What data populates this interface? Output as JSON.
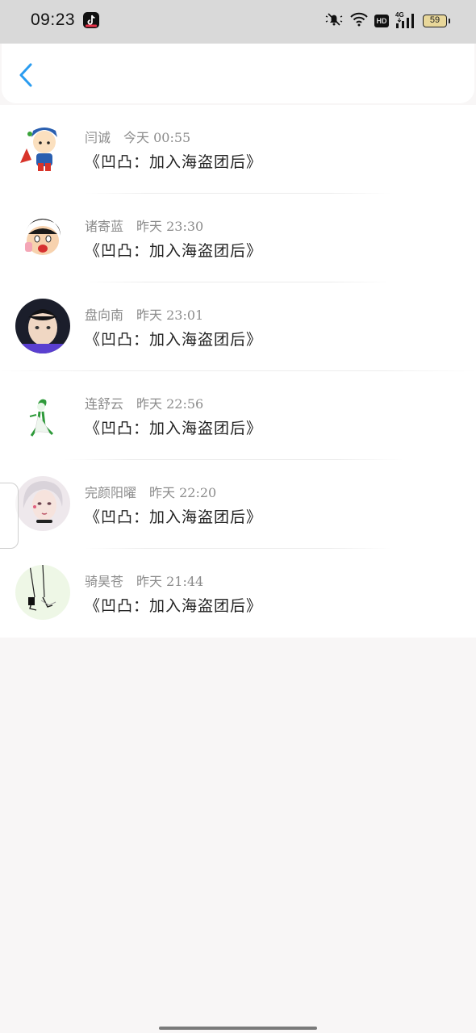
{
  "status_bar": {
    "time": "09:23",
    "battery": "59",
    "network": "4G",
    "hd": "HD"
  },
  "header": {
    "back_icon": "chevron-left-icon",
    "accent_color": "#2a9cf0"
  },
  "messages": [
    {
      "name": "闫诚",
      "time": "今天 00:55",
      "text": "《凹凸：加入海盗团后》"
    },
    {
      "name": "诸寄蓝",
      "time": "昨天 23:30",
      "text": "《凹凸：加入海盗团后》"
    },
    {
      "name": "盘向南",
      "time": "昨天 23:01",
      "text": "《凹凸：加入海盗团后》"
    },
    {
      "name": "连舒云",
      "time": "昨天 22:56",
      "text": "《凹凸：加入海盗团后》"
    },
    {
      "name": "完颜阳曜",
      "time": "昨天 22:20",
      "text": "《凹凸：加入海盗团后》"
    },
    {
      "name": "骑昊苍",
      "time": "昨天 21:44",
      "text": "《凹凸：加入海盗团后》"
    }
  ]
}
